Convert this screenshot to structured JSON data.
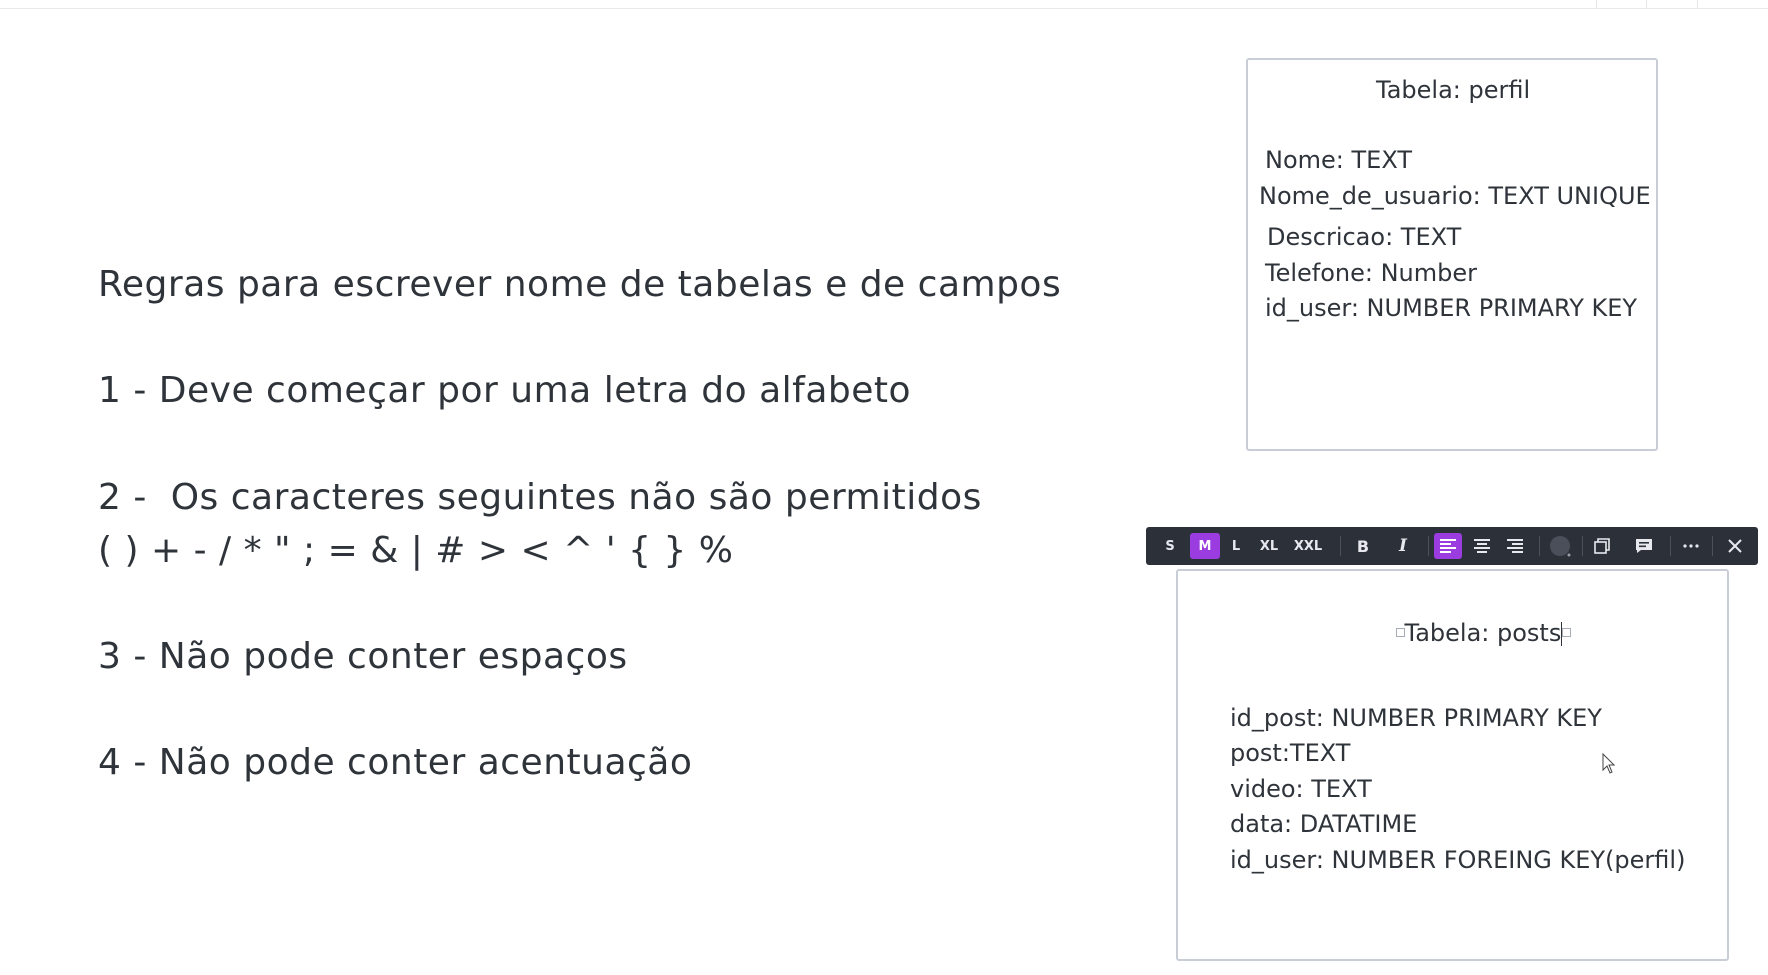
{
  "rules": {
    "heading": "Regras para escrever nome de tabelas e de campos",
    "rule1": "1 - Deve começar por uma letra do alfabeto",
    "rule2": "2 -  Os caracteres seguintes não são permitidos",
    "rule2_chars": "( ) + - / * \" ; = & | # > < ^ ' { } %",
    "rule3": "3 - Não pode conter espaços",
    "rule4": "4 - Não pode conter acentuação"
  },
  "perfil_card": {
    "title": "Tabela: perfil",
    "fields": [
      "Nome: TEXT",
      "Nome_de_usuario: TEXT UNIQUE",
      "Descricao: TEXT",
      "Telefone: Number",
      "id_user: NUMBER PRIMARY KEY"
    ]
  },
  "posts_card": {
    "title": "Tabela: posts",
    "fields": [
      "id_post: NUMBER PRIMARY KEY",
      "post:TEXT",
      "video: TEXT",
      "data: DATATIME",
      "id_user: NUMBER FOREING KEY(perfil)"
    ]
  },
  "toolbar": {
    "size_s": "S",
    "size_m": "M",
    "size_l": "L",
    "size_xl": "XL",
    "size_xxl": "XXL",
    "bold": "B",
    "italic": "I",
    "active_size": "M",
    "active_align": "left",
    "accent_color": "#9b3ce0",
    "icons": [
      "align-left-icon",
      "align-center-icon",
      "align-right-icon",
      "color-swatch-icon",
      "duplicate-icon",
      "comment-icon",
      "more-icon",
      "close-icon"
    ]
  }
}
